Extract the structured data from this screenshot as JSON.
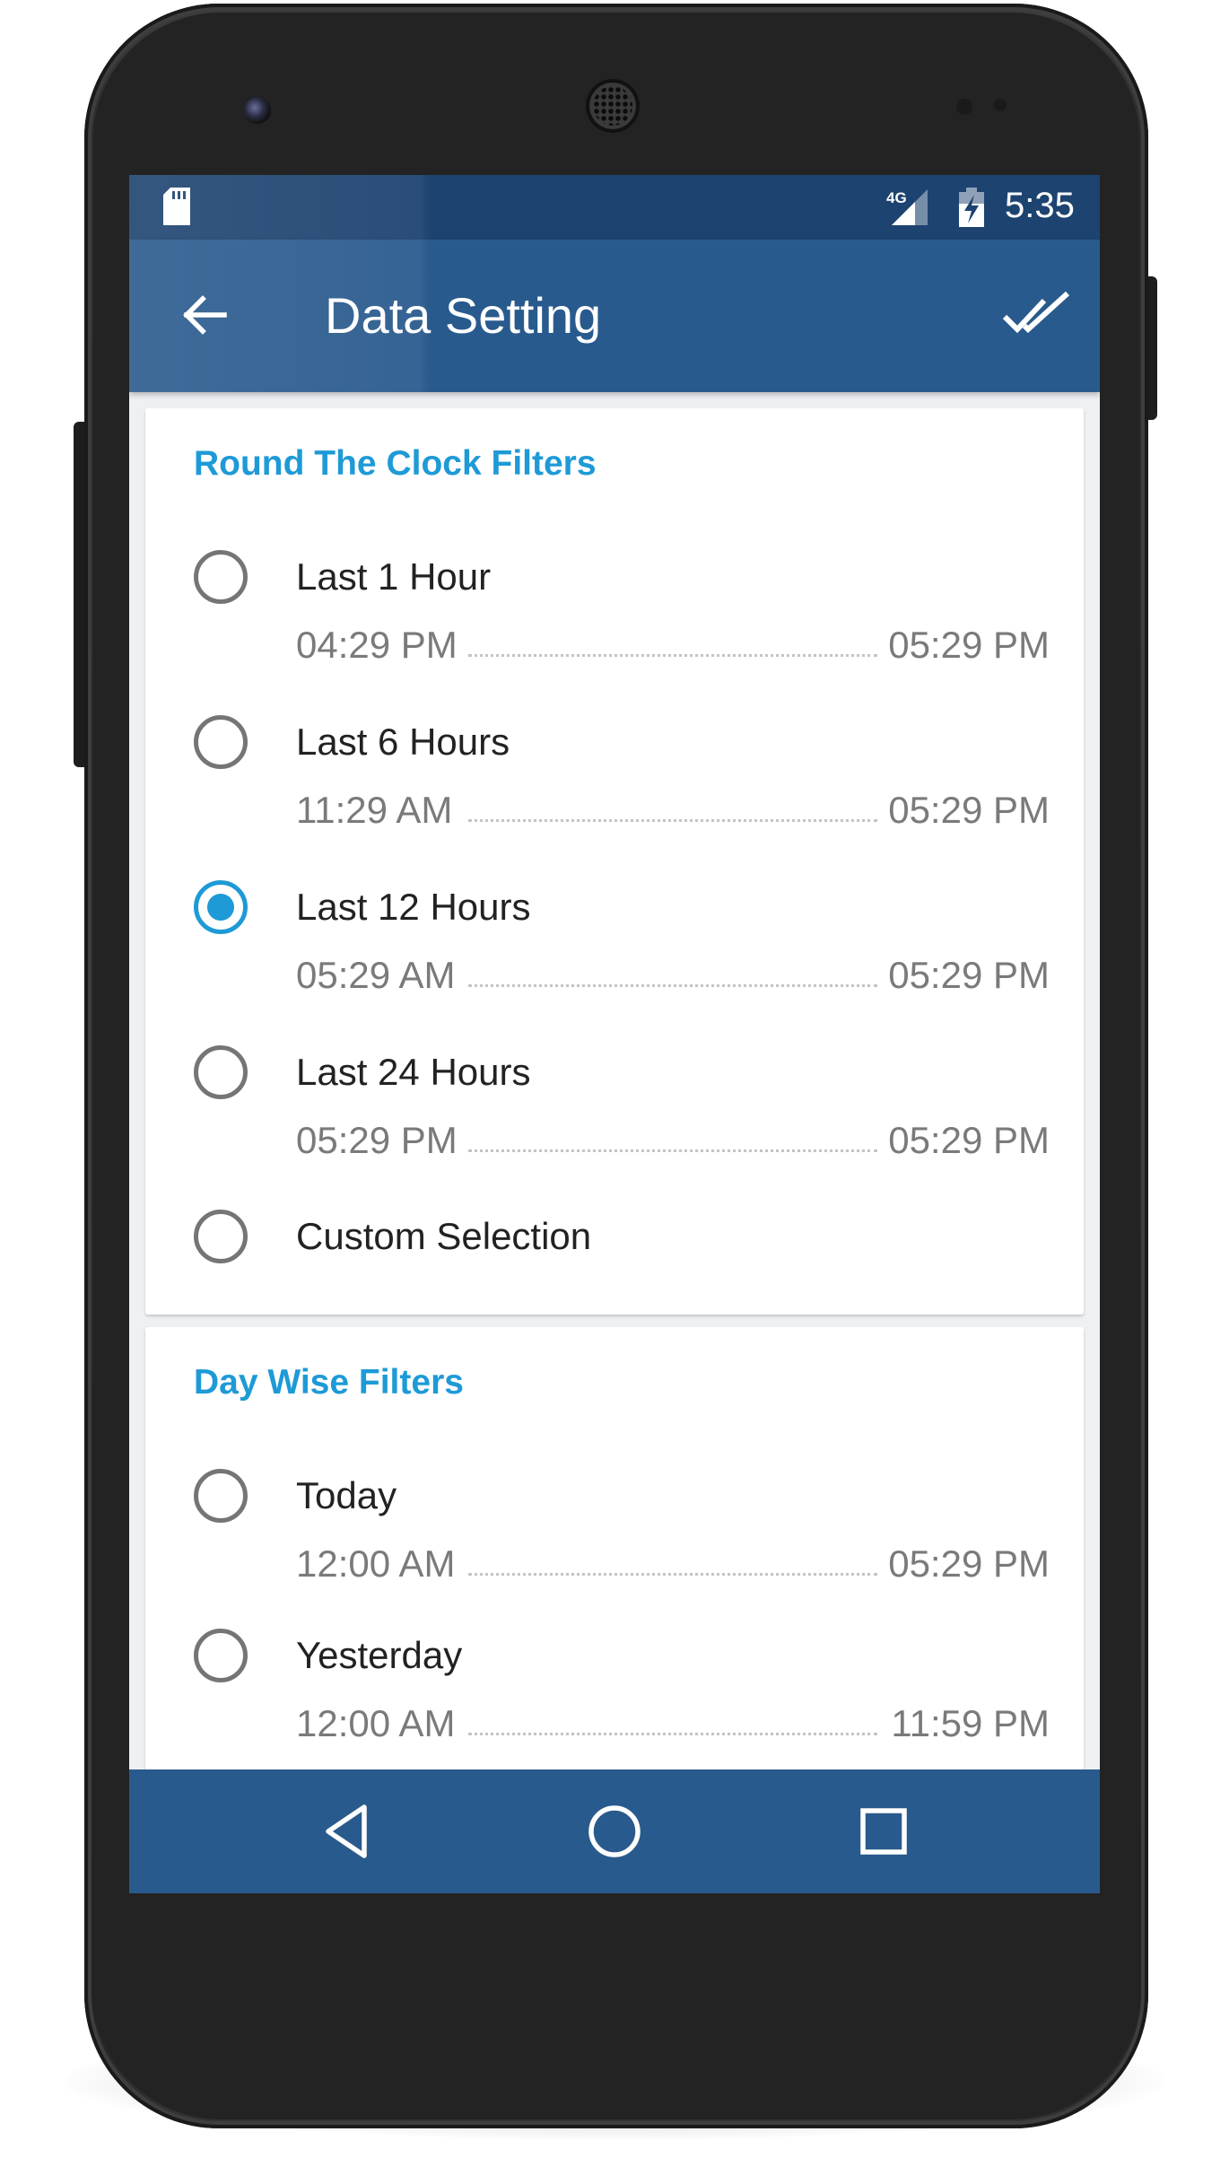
{
  "status_bar": {
    "network": "4G",
    "time": "5:35"
  },
  "app_bar": {
    "title": "Data Setting"
  },
  "round_the_clock": {
    "title": "Round The Clock Filters",
    "options": [
      {
        "label": "Last 1 Hour",
        "start": "04:29 PM",
        "end": "05:29 PM",
        "selected": false
      },
      {
        "label": "Last 6 Hours",
        "start": "11:29 AM",
        "end": "05:29 PM",
        "selected": false
      },
      {
        "label": "Last 12 Hours",
        "start": "05:29 AM",
        "end": "05:29 PM",
        "selected": true
      },
      {
        "label": "Last 24 Hours",
        "start": "05:29 PM",
        "end": "05:29 PM",
        "selected": false
      },
      {
        "label": "Custom Selection",
        "selected": false
      }
    ]
  },
  "day_wise": {
    "title": "Day Wise Filters",
    "options": [
      {
        "label": "Today",
        "start": "12:00 AM",
        "end": "05:29 PM",
        "selected": false
      },
      {
        "label": "Yesterday",
        "start": "12:00 AM",
        "end": "11:59 PM",
        "selected": false
      }
    ]
  },
  "colors": {
    "status_bar": "#1d4370",
    "app_bar": "#295a8d",
    "accent": "#1e9ad6",
    "background": "#eef1f4"
  },
  "icons": {
    "back": "arrow-left-icon",
    "confirm": "double-check-icon",
    "nav_back": "triangle-back-icon",
    "nav_home": "circle-home-icon",
    "nav_recents": "square-recents-icon"
  }
}
